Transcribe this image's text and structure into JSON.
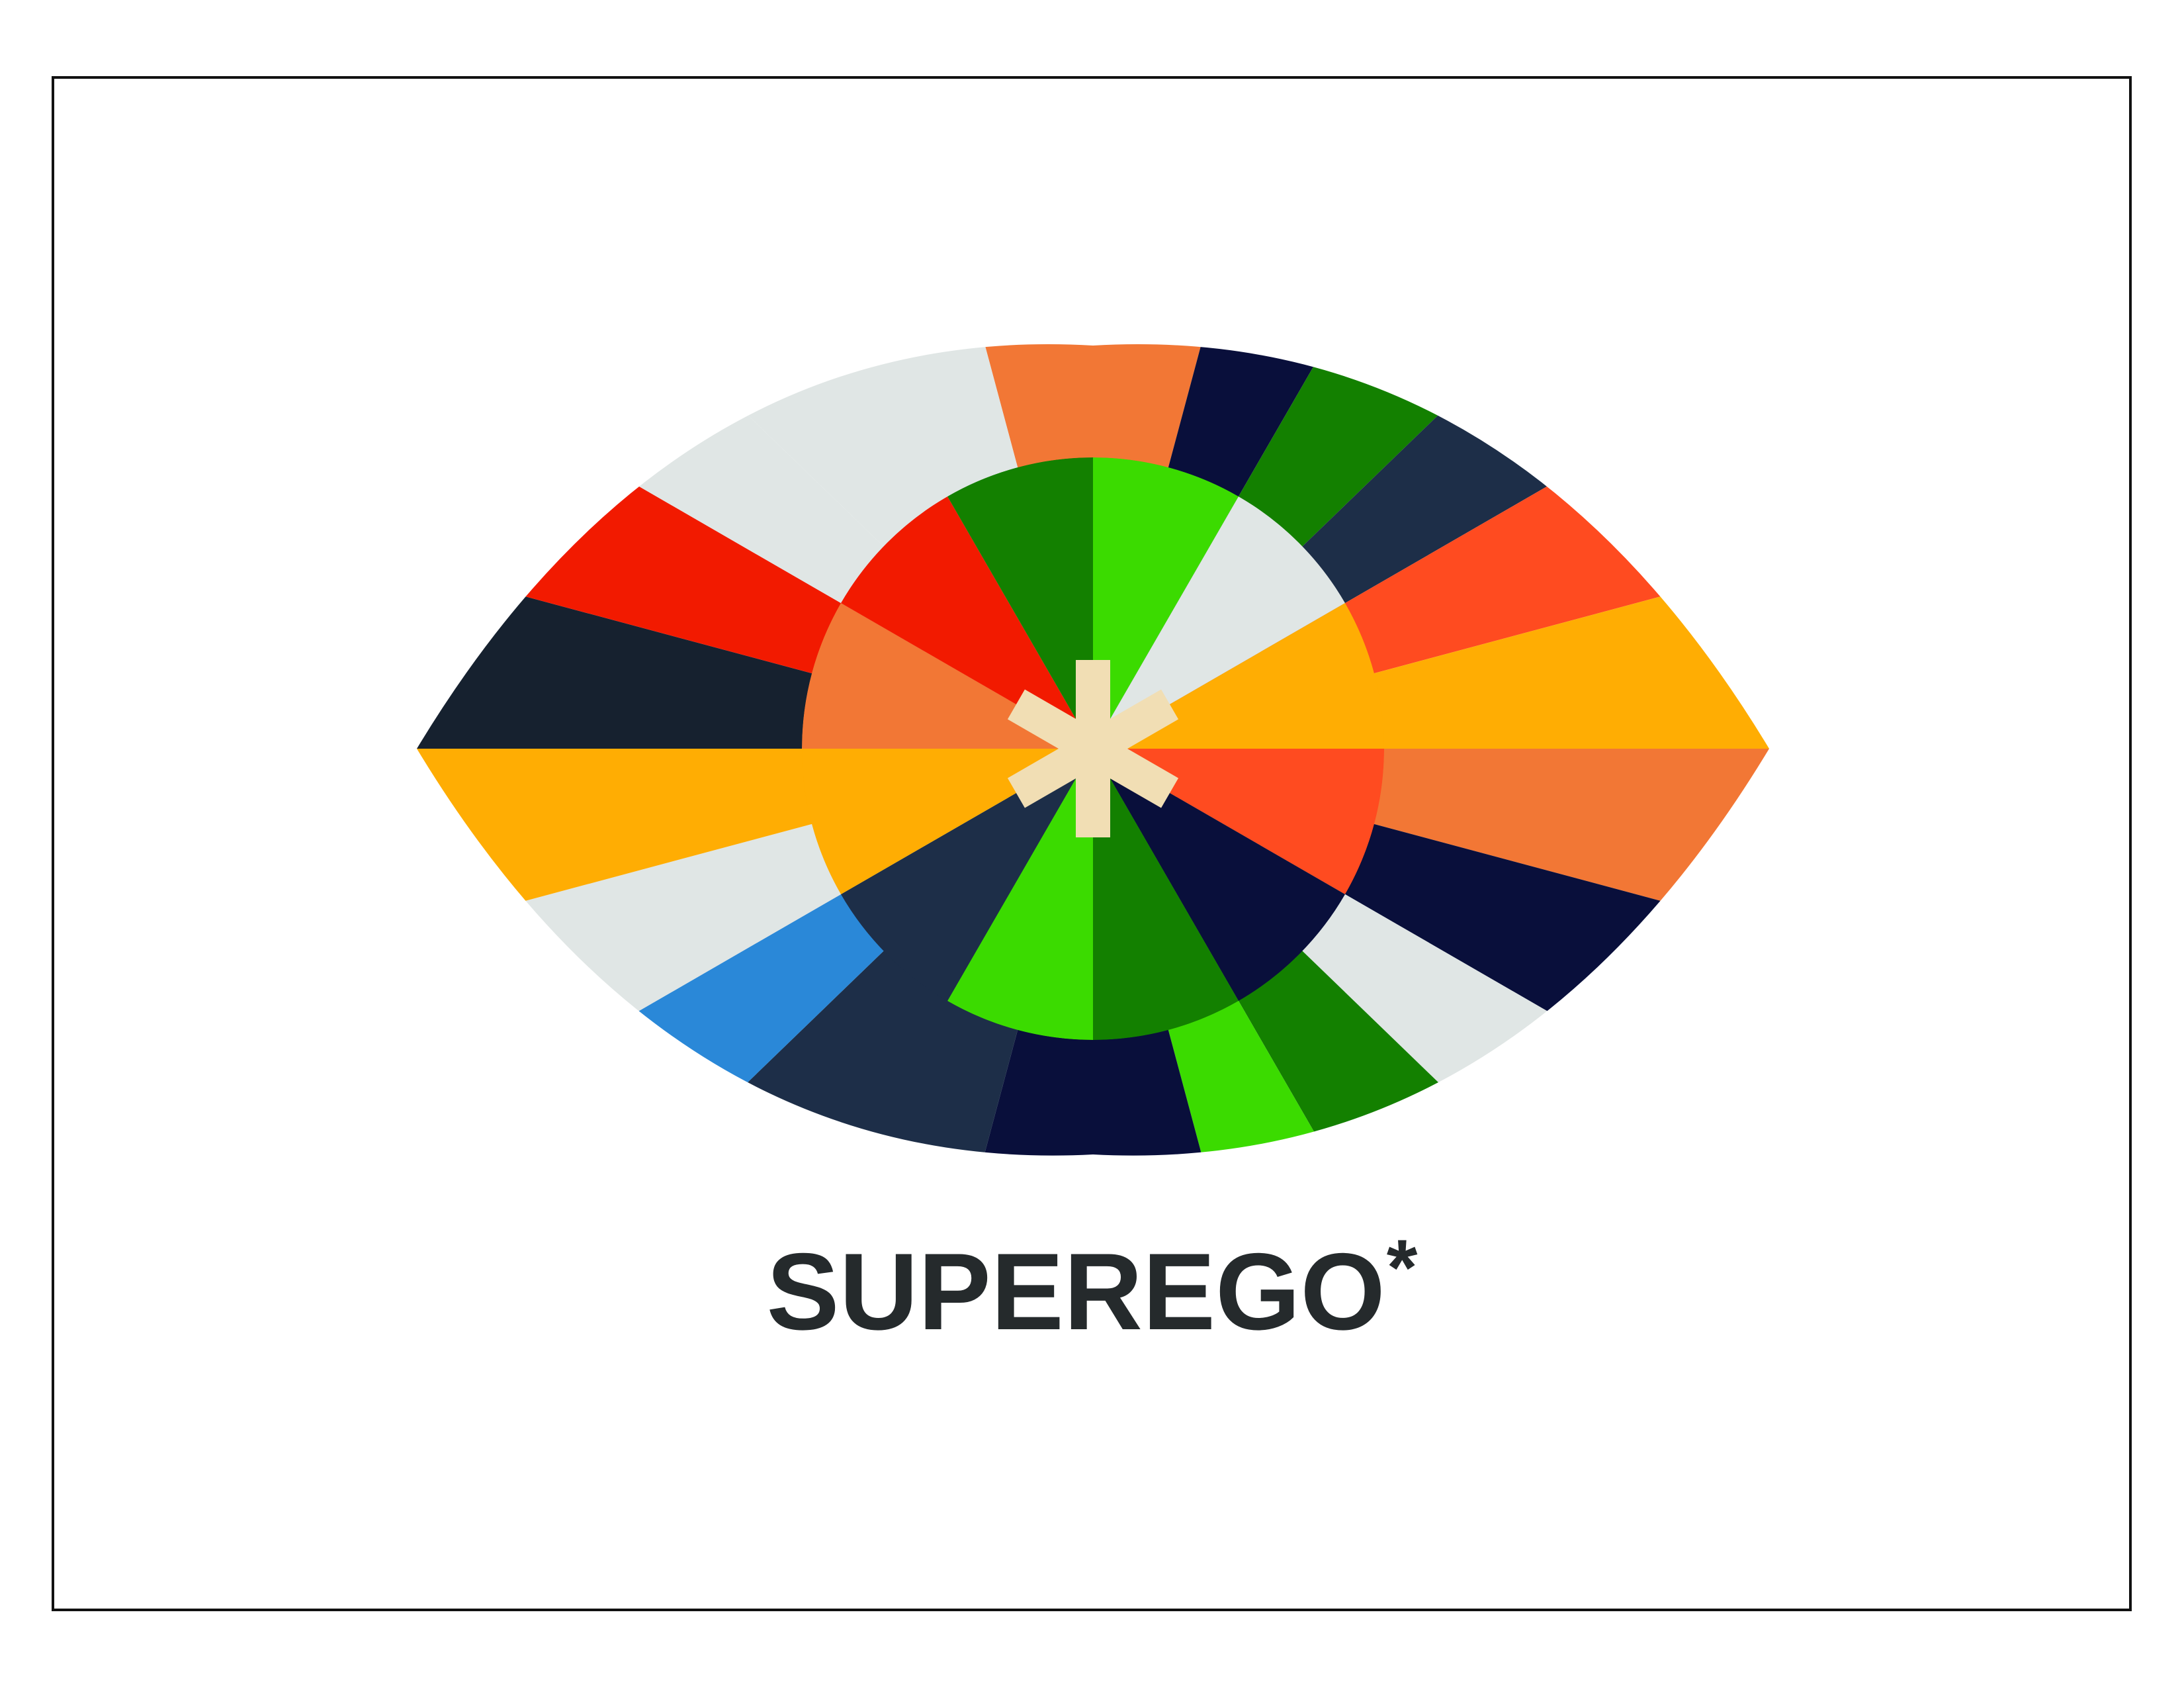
{
  "brand": {
    "name": "SUPEREGO",
    "mark": "*"
  },
  "colors": {
    "background": "#ffffff",
    "frame": "#111111",
    "wordmark": "#252a2c",
    "asterisk": "#f1deb4",
    "outer": [
      "#1c2b46",
      "#e0e6e5",
      "#f1deb4"
    ],
    "palette": {
      "orange": "#f27735",
      "navy": "#090f3b",
      "dark_green": "#138000",
      "slate": "#1d2e48",
      "red_orange": "#ff4b20",
      "amber": "#ffad03",
      "light_gray": "#e0e6e5",
      "blue": "#2a88d8",
      "bright_green": "#3bdb00",
      "red": "#f21a00",
      "charcoal": "#16212f"
    },
    "outer_wedges": [
      "orange",
      "navy",
      "dark_green",
      "slate",
      "red_orange",
      "amber",
      "orange",
      "navy",
      "light_gray",
      "dark_green",
      "bright_green",
      "navy",
      "slate",
      "blue",
      "light_gray",
      "amber",
      "charcoal",
      "red",
      "light_gray"
    ],
    "inner_wedges": [
      "bright_green",
      "light_gray",
      "amber",
      "red_orange",
      "navy",
      "dark_green",
      "bright_green",
      "slate",
      "amber",
      "orange",
      "red",
      "dark_green"
    ]
  },
  "icons": {
    "logo": "eye-icon",
    "center": "asterisk-icon"
  }
}
